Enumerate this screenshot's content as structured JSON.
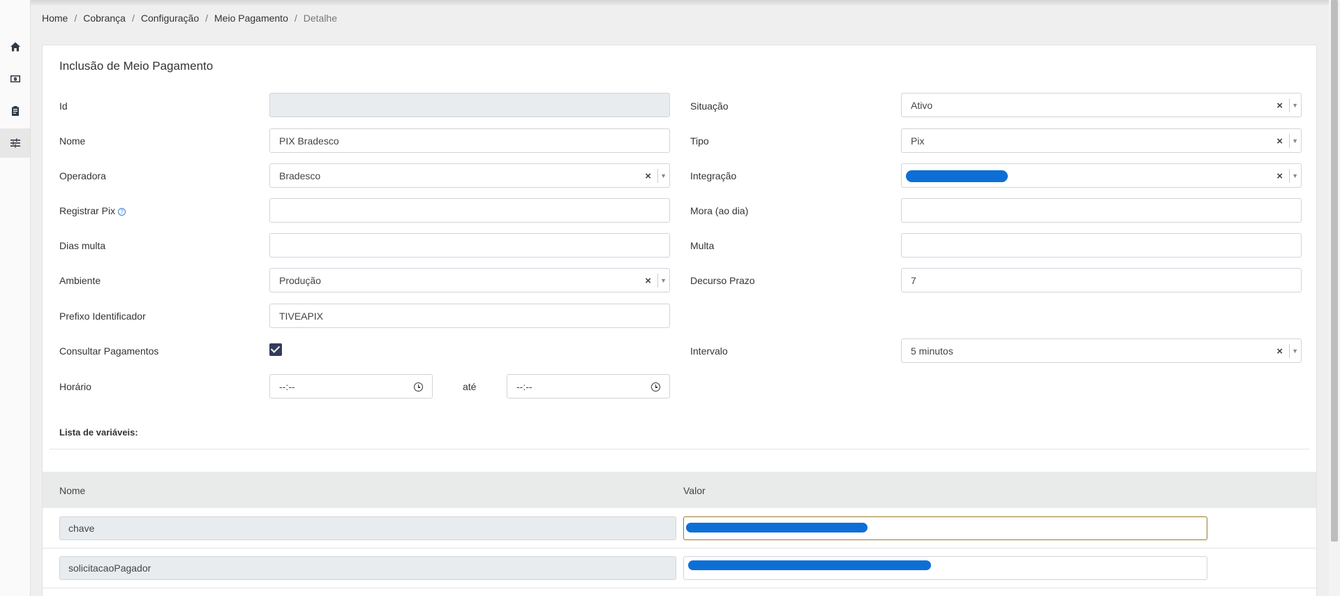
{
  "breadcrumb": {
    "items": [
      "Home",
      "Cobrança",
      "Configuração",
      "Meio Pagamento"
    ],
    "current": "Detalhe",
    "separator": "/"
  },
  "sidebar": {
    "items": [
      {
        "icon": "home-icon"
      },
      {
        "icon": "money-icon"
      },
      {
        "icon": "clipboard-icon"
      },
      {
        "icon": "sliders-icon",
        "active": true
      }
    ]
  },
  "form": {
    "title": "Inclusão de Meio Pagamento",
    "id": {
      "label": "Id",
      "value": ""
    },
    "situacao": {
      "label": "Situação",
      "value": "Ativo"
    },
    "nome": {
      "label": "Nome",
      "value": "PIX Bradesco"
    },
    "tipo": {
      "label": "Tipo",
      "value": "Pix"
    },
    "operadora": {
      "label": "Operadora",
      "value": "Bradesco"
    },
    "integracao": {
      "label": "Integração",
      "value": ""
    },
    "registrar_pix": {
      "label": "Registrar Pix",
      "value": ""
    },
    "mora": {
      "label": "Mora (ao dia)",
      "value": ""
    },
    "dias_multa": {
      "label": "Dias multa",
      "value": ""
    },
    "multa": {
      "label": "Multa",
      "value": ""
    },
    "ambiente": {
      "label": "Ambiente",
      "value": "Produção"
    },
    "decurso_prazo": {
      "label": "Decurso Prazo",
      "value": "7"
    },
    "prefixo": {
      "label": "Prefixo Identificador",
      "value": "TIVEAPIX"
    },
    "consultar": {
      "label": "Consultar Pagamentos",
      "checked": true
    },
    "intervalo": {
      "label": "Intervalo",
      "value": "5 minutos"
    },
    "horario": {
      "label": "Horário",
      "from": "--:--",
      "to_label": "até",
      "to": "--:--"
    },
    "clear_symbol": "×",
    "arrow_symbol": "▼"
  },
  "variables": {
    "title": "Lista de variáveis:",
    "col_nome": "Nome",
    "col_valor": "Valor",
    "rows": [
      {
        "nome": "chave",
        "valor": ""
      },
      {
        "nome": "solicitacaoPagador",
        "valor": ""
      }
    ]
  },
  "colors": {
    "redaction": "#0d6fd6",
    "checkbox": "#333c5a",
    "focus_border": "#9a7a2c"
  }
}
